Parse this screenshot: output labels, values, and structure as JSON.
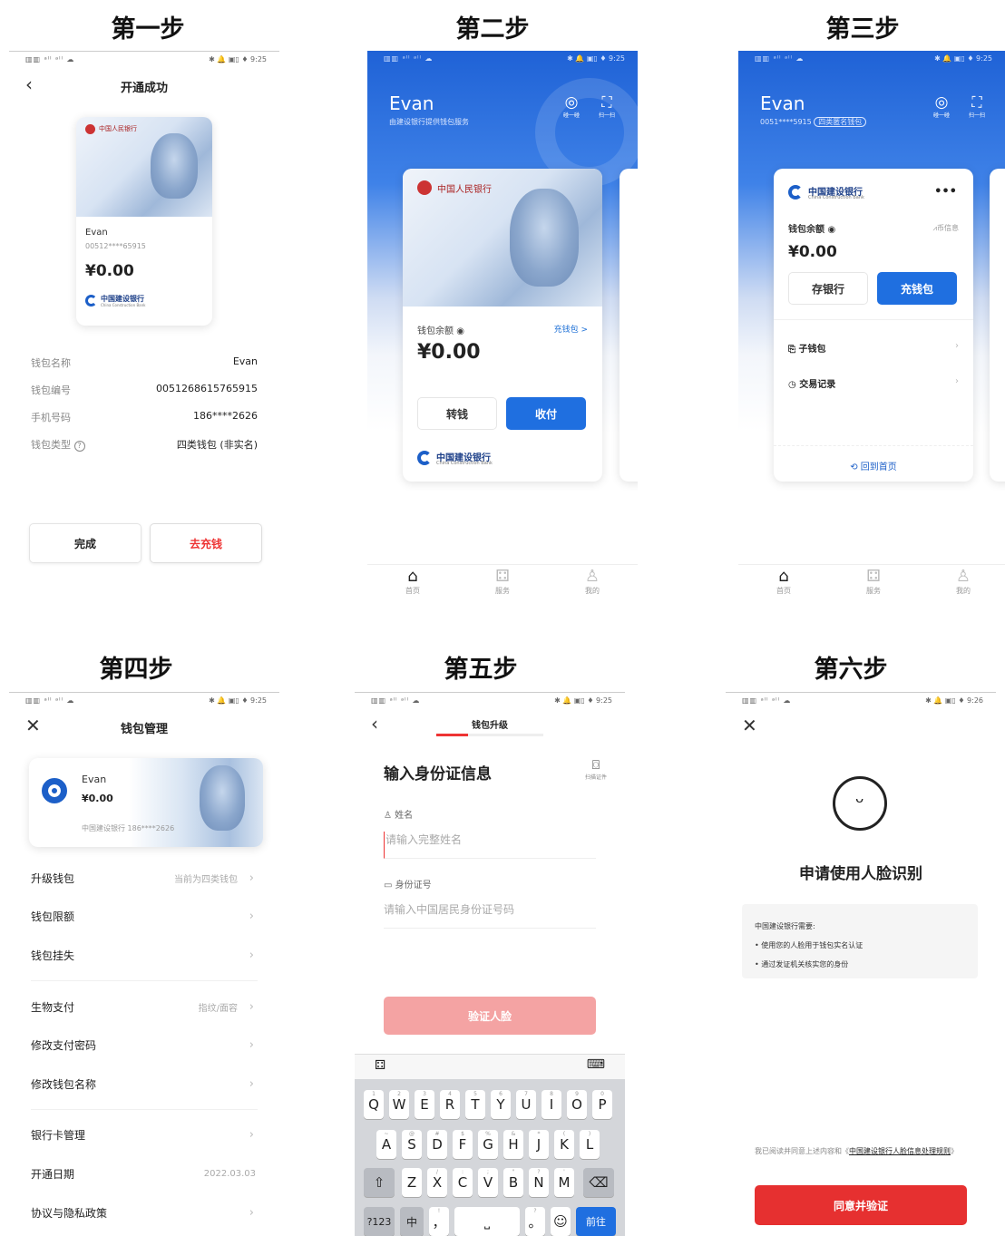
{
  "steps": [
    "第一步",
    "第二步",
    "第三步",
    "第四步",
    "第五步",
    "第六步"
  ],
  "status": {
    "signal": "▥▥ ᵃˡˡ ᵃˡˡ ☁",
    "time1": "✱ 🔔 ▣▯ ♦ 9:25",
    "time6": "✱ 🔔 ▣▯ ♦ 9:26"
  },
  "p1": {
    "title": "开通成功",
    "bank_header": "中国人民银行",
    "name": "Evan",
    "number_masked": "00512****65915",
    "balance": "¥0.00",
    "bank_name": "中国建设银行",
    "bank_en": "China Construction Bank",
    "rows": [
      {
        "k": "钱包名称",
        "v": "Evan"
      },
      {
        "k": "钱包编号",
        "v": "0051268615765915"
      },
      {
        "k": "手机号码",
        "v": "186****2626"
      },
      {
        "k": "钱包类型",
        "v": "四类钱包 (非实名)"
      }
    ],
    "help_icon": "?",
    "done": "完成",
    "topup": "去充钱"
  },
  "p2": {
    "user": "Evan",
    "subtitle": "由建设银行提供钱包服务",
    "scan_label": "碰一碰",
    "scan2_label": "扫一扫",
    "bank_header": "中国人民银行",
    "balance_label": "钱包余额",
    "topup": "充钱包 >",
    "balance": "¥0.00",
    "transfer": "转钱",
    "receive": "收付",
    "bank_name": "中国建设银行",
    "bank_en": "China Construction Bank",
    "nav": [
      "首页",
      "服务",
      "我的"
    ]
  },
  "p3": {
    "user": "Evan",
    "subtitle": "0051****5915",
    "badge": "四类匿名钱包",
    "scan_label": "碰一碰",
    "scan2_label": "扫一扫",
    "bank_name": "中国建设银行",
    "bank_en": "China Construction Bank",
    "more": "•••",
    "balance_label": "钱包余额",
    "info": "币信息",
    "balance": "¥0.00",
    "deposit": "存银行",
    "topup": "充钱包",
    "sub_wallet": "子钱包",
    "records": "交易记录",
    "home_link": "回到首页",
    "nav": [
      "首页",
      "服务",
      "我的"
    ]
  },
  "p4": {
    "title": "钱包管理",
    "name": "Evan",
    "balance": "¥0.00",
    "bank_line": "中国建设银行 186****2626",
    "items": [
      {
        "label": "升级钱包",
        "sub": "当前为四类钱包"
      },
      {
        "label": "钱包限额",
        "sub": ""
      },
      {
        "label": "钱包挂失",
        "sub": ""
      },
      {
        "label": "生物支付",
        "sub": "指纹/面容"
      },
      {
        "label": "修改支付密码",
        "sub": ""
      },
      {
        "label": "修改钱包名称",
        "sub": ""
      },
      {
        "label": "银行卡管理",
        "sub": ""
      },
      {
        "label": "开通日期",
        "sub": "2022.03.03"
      },
      {
        "label": "协议与隐私政策",
        "sub": ""
      }
    ]
  },
  "p5": {
    "title": "钱包升级",
    "heading": "输入身份证信息",
    "scan_label": "扫描证件",
    "name_label": "姓名",
    "name_ph": "请输入完整姓名",
    "id_label": "身份证号",
    "id_ph": "请输入中国居民身份证号码",
    "verify": "验证人脸",
    "row1": [
      "Q",
      "W",
      "E",
      "R",
      "T",
      "Y",
      "U",
      "I",
      "O",
      "P"
    ],
    "row1s": [
      "1",
      "2",
      "3",
      "4",
      "5",
      "6",
      "7",
      "8",
      "9",
      "0"
    ],
    "row2": [
      "A",
      "S",
      "D",
      "F",
      "G",
      "H",
      "J",
      "K",
      "L"
    ],
    "row2s": [
      "~",
      "@",
      "#",
      "$",
      "%",
      "&",
      "*",
      "(",
      ")"
    ],
    "row3": [
      "Z",
      "X",
      "C",
      "V",
      "B",
      "N",
      "M"
    ],
    "row3s": [
      "",
      "/",
      ":",
      ";",
      "\"",
      "?",
      "'"
    ],
    "k123": "?123",
    "kzh": "中",
    "kcomma": "，",
    "kperiod": "。",
    "kgo": "前往",
    "kshift": "⇧",
    "kdel": "⌫",
    "kemoji": "☺"
  },
  "p6": {
    "heading": "申请使用人脸识别",
    "intro": "中国建设银行需要:",
    "bullets": [
      "使用您的人脸用于钱包实名认证",
      "通过发证机关核实您的身份"
    ],
    "agree_pre": "我已阅读并同意上述内容和《",
    "agree_link": "中国建设银行人脸信息处理规则",
    "agree_post": "》",
    "button": "同意并验证"
  }
}
